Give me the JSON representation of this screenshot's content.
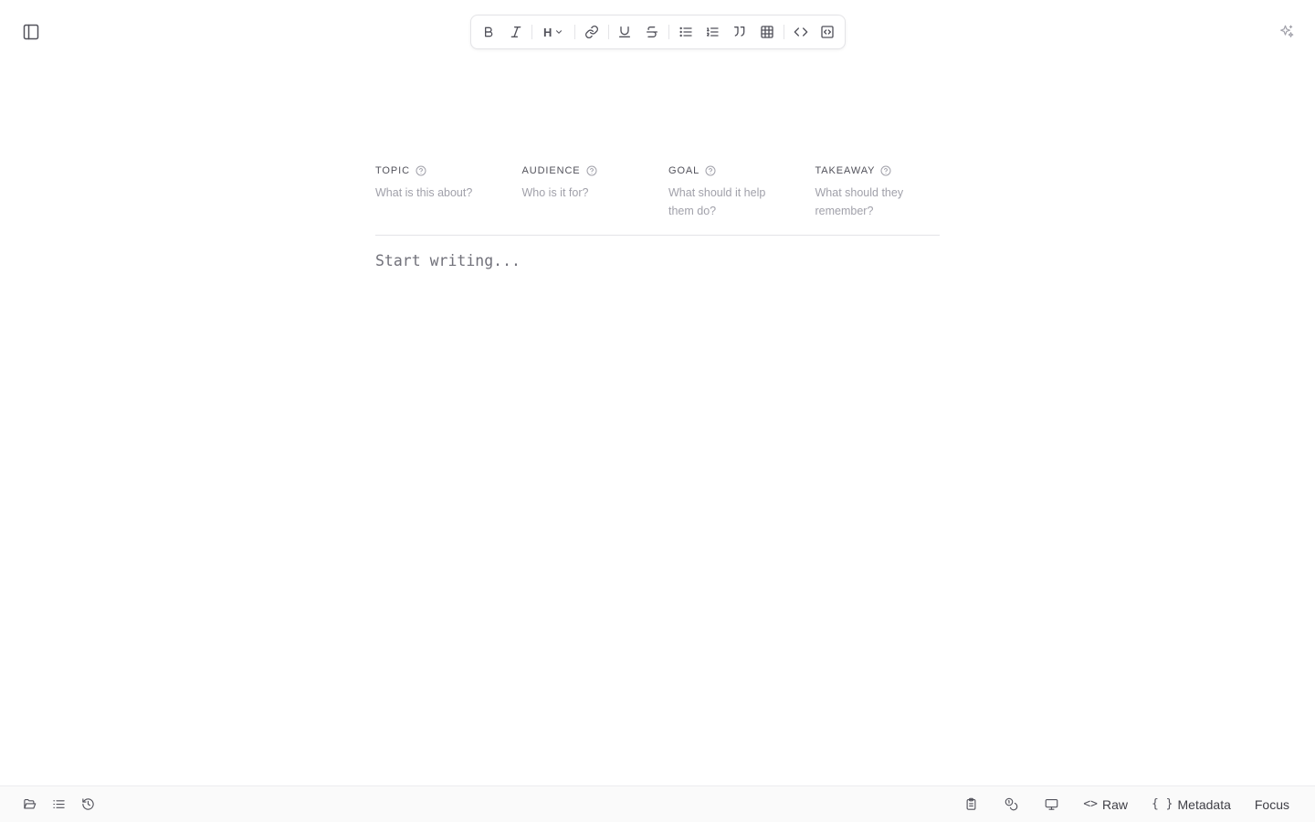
{
  "header": {
    "sidebar_toggle_icon": "panel-left-icon",
    "ai_icon": "sparkles-icon"
  },
  "toolbar": {
    "heading_label": "H",
    "buttons": [
      "bold",
      "italic",
      "heading",
      "link",
      "underline",
      "strikethrough",
      "bullet-list",
      "numbered-list",
      "quote",
      "table",
      "inline-code",
      "code-block"
    ]
  },
  "brief": {
    "fields": [
      {
        "label": "TOPIC",
        "placeholder": "What is this about?"
      },
      {
        "label": "AUDIENCE",
        "placeholder": "Who is it for?"
      },
      {
        "label": "GOAL",
        "placeholder": "What should it help them do?"
      },
      {
        "label": "TAKEAWAY",
        "placeholder": "What should they remember?"
      }
    ]
  },
  "editor": {
    "placeholder": "Start writing..."
  },
  "bottombar": {
    "left_icons": [
      "folder-open-icon",
      "list-icon",
      "history-icon"
    ],
    "right_icons": [
      "clipboard-icon",
      "coins-icon",
      "monitor-icon"
    ],
    "raw_glyph": "<>",
    "raw_label": "Raw",
    "metadata_glyph": "{ }",
    "metadata_label": "Metadata",
    "focus_label": "Focus"
  },
  "colors": {
    "text": "#3f3f46",
    "muted": "#a1a1aa",
    "border": "#e4e4e7",
    "bottombar_bg": "#fafafa"
  }
}
